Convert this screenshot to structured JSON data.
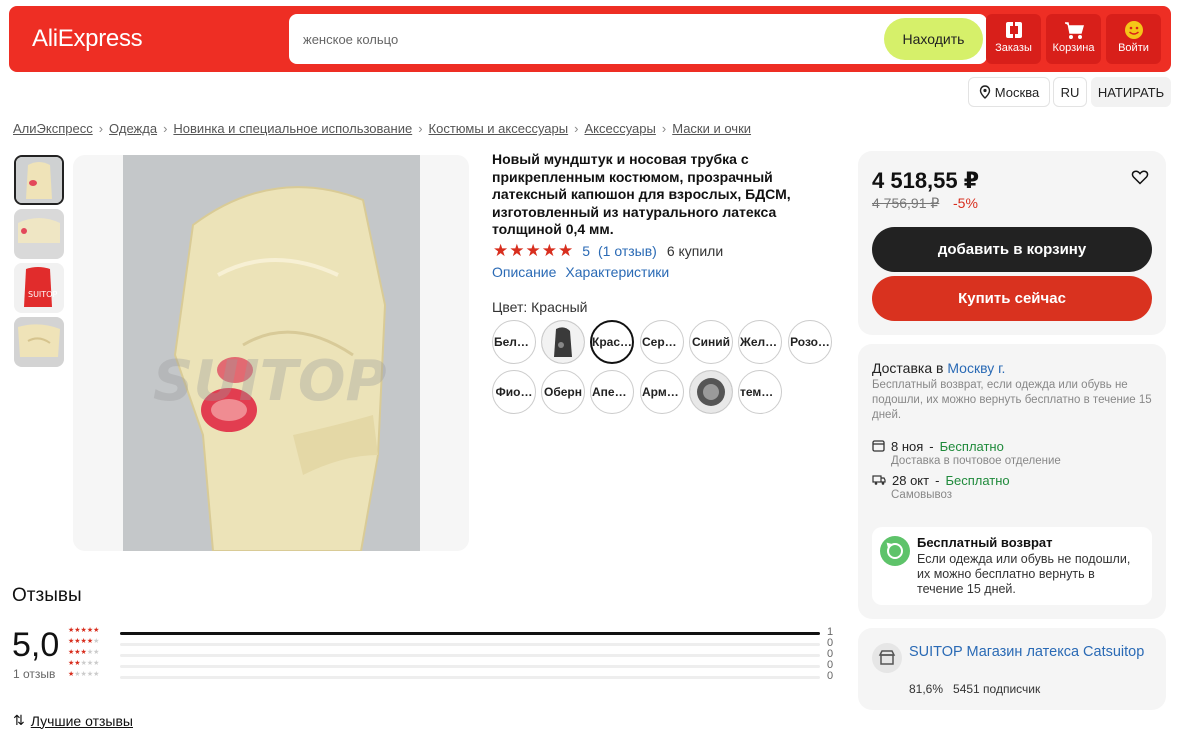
{
  "header": {
    "logo": "AliExpress",
    "search_placeholder": "женское кольцо",
    "search_button": "Находить",
    "orders_label": "Заказы",
    "cart_label": "Корзина",
    "login_label": "Войти",
    "brand_color": "#ee2e24"
  },
  "subheader": {
    "city": "Москва",
    "language": "RU",
    "settings": "НАТИРАТЬ"
  },
  "breadcrumb": [
    "АлиЭкспресс",
    "Одежда",
    "Новинка и специальное использование",
    "Костюмы и аксессуары",
    "Аксессуары",
    "Маски и очки"
  ],
  "product": {
    "title": "Новый мундштук и носовая трубка с прикрепленным костюмом, прозрачный латексный капюшон для взрослых, БДСМ, изготовленный из натурального латекса толщиной 0,4 мм.",
    "rating_value": "5",
    "rating_count": "(1 отзыв)",
    "sold": "6 купили",
    "tab_description": "Описание",
    "tab_specs": "Характеристики",
    "color_label": "Цвет: Красный",
    "watermark": "SUITOP",
    "colors": [
      "Белый",
      "",
      "Крас…",
      "Серый",
      "Синий",
      "Желт…",
      "Розо…",
      "Фио…",
      "Оберн",
      "Апел…",
      "Арме…",
      "",
      "темн…"
    ]
  },
  "reviews": {
    "heading": "Отзывы",
    "average": "5,0",
    "count_label": "1 отзыв",
    "distribution": [
      {
        "stars": 5,
        "count": "1",
        "fraction": 1.0
      },
      {
        "stars": 4,
        "count": "0",
        "fraction": 0.0
      },
      {
        "stars": 3,
        "count": "0",
        "fraction": 0.0
      },
      {
        "stars": 2,
        "count": "0",
        "fraction": 0.0
      },
      {
        "stars": 1,
        "count": "0",
        "fraction": 0.0
      }
    ],
    "best_link": "Лучшие отзывы"
  },
  "buy": {
    "price": "4 518,55 ₽",
    "old_price": "4 756,91 ₽",
    "discount": "-5%",
    "add_to_cart": "добавить в корзину",
    "buy_now": "Купить сейчас"
  },
  "delivery": {
    "heading_prefix": "Доставка в",
    "heading_city": "Москву г.",
    "note": "Бесплатный возврат,  если одежда или обувь не подошли, их можно вернуть бесплатно в течение 15 дней.",
    "option1_date": "8 ноя",
    "option1_price": "Бесплатно",
    "option1_sub": "Доставка в почтовое отделение",
    "option2_date": "28 окт",
    "option2_price": "Бесплатно",
    "option2_sub": "Самовывоз",
    "return_title": "Бесплатный возврат",
    "return_text": "Если одежда или обувь не подошли, их можно бесплатно вернуть в течение 15 дней."
  },
  "store": {
    "name": "SUITOP Магазин латекса Catsuitop",
    "rating": "81,6%",
    "subscribers": "5451 подписчик"
  }
}
